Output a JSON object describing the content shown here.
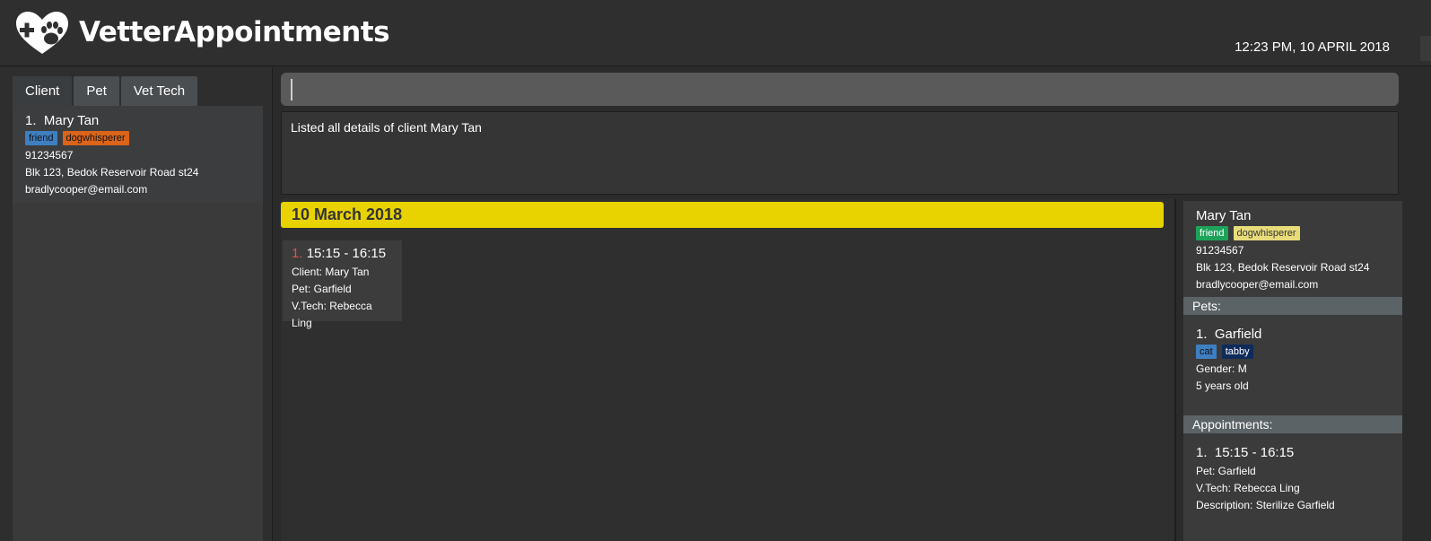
{
  "app": {
    "title": "VetterAppointments",
    "clock": "12:23 PM, 10 APRIL 2018"
  },
  "tabs": [
    {
      "label": "Client"
    },
    {
      "label": "Pet"
    },
    {
      "label": "Vet Tech"
    }
  ],
  "client_list": [
    {
      "index": "1.",
      "name": "Mary Tan",
      "tags": [
        "friend",
        "dogwhisperer"
      ],
      "phone": "91234567",
      "address": "Blk 123, Bedok Reservoir Road st24",
      "email": "bradlycooper@email.com"
    }
  ],
  "command": {
    "value": ""
  },
  "result": {
    "message": "Listed all details of client Mary Tan"
  },
  "calendar": {
    "date": "10 March 2018",
    "appointments": [
      {
        "index": "1.",
        "time": "15:15 - 16:15",
        "client": "Client: Mary Tan",
        "pet": "Pet: Garfield",
        "vettech": "V.Tech: Rebecca Ling"
      }
    ]
  },
  "detail": {
    "client": {
      "name": "Mary Tan",
      "tags": [
        "friend",
        "dogwhisperer"
      ],
      "phone": "91234567",
      "address": "Blk 123, Bedok Reservoir Road st24",
      "email": "bradlycooper@email.com"
    },
    "pets_header": "Pets:",
    "pets": [
      {
        "index": "1.",
        "name": "Garfield",
        "tags": [
          "cat",
          "tabby"
        ],
        "gender": "Gender: M",
        "age": "5 years old"
      }
    ],
    "appointments_header": "Appointments:",
    "appointments": [
      {
        "index": "1.",
        "time": "15:15 - 16:15",
        "pet": "Pet: Garfield",
        "vettech": "V.Tech: Rebecca Ling",
        "description": "Description: Sterilize Garfield"
      }
    ]
  },
  "colors": {
    "tag_friend_left": "#3e7fc1",
    "tag_dogwhisperer_left": "#d9641a",
    "tag_friend_right": "#1ea35a",
    "tag_dogwhisperer_right": "#e8dc7a",
    "tag_cat": "#3e7fc1",
    "tag_tabby": "#0f2b5a",
    "date_bar": "#e8d200"
  }
}
